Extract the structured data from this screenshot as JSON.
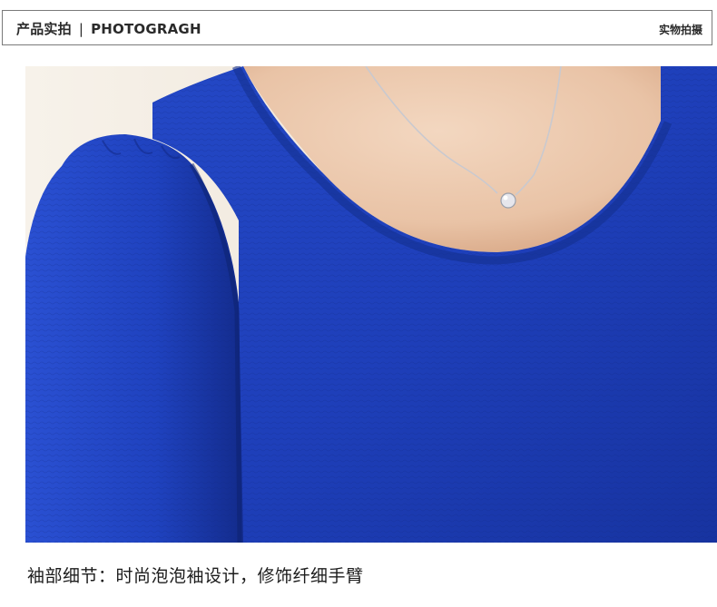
{
  "header": {
    "title_cn": "产品实拍",
    "separator": "|",
    "title_en": "PHOTOGRAGH",
    "right_label": "实物拍摄"
  },
  "caption": {
    "text": "袖部细节：时尚泡泡袖设计，修饰纤细手臂"
  },
  "colors": {
    "garment_blue": "#1d3fb8",
    "skin": "#ecc9ae",
    "background": "#f3ece2"
  }
}
